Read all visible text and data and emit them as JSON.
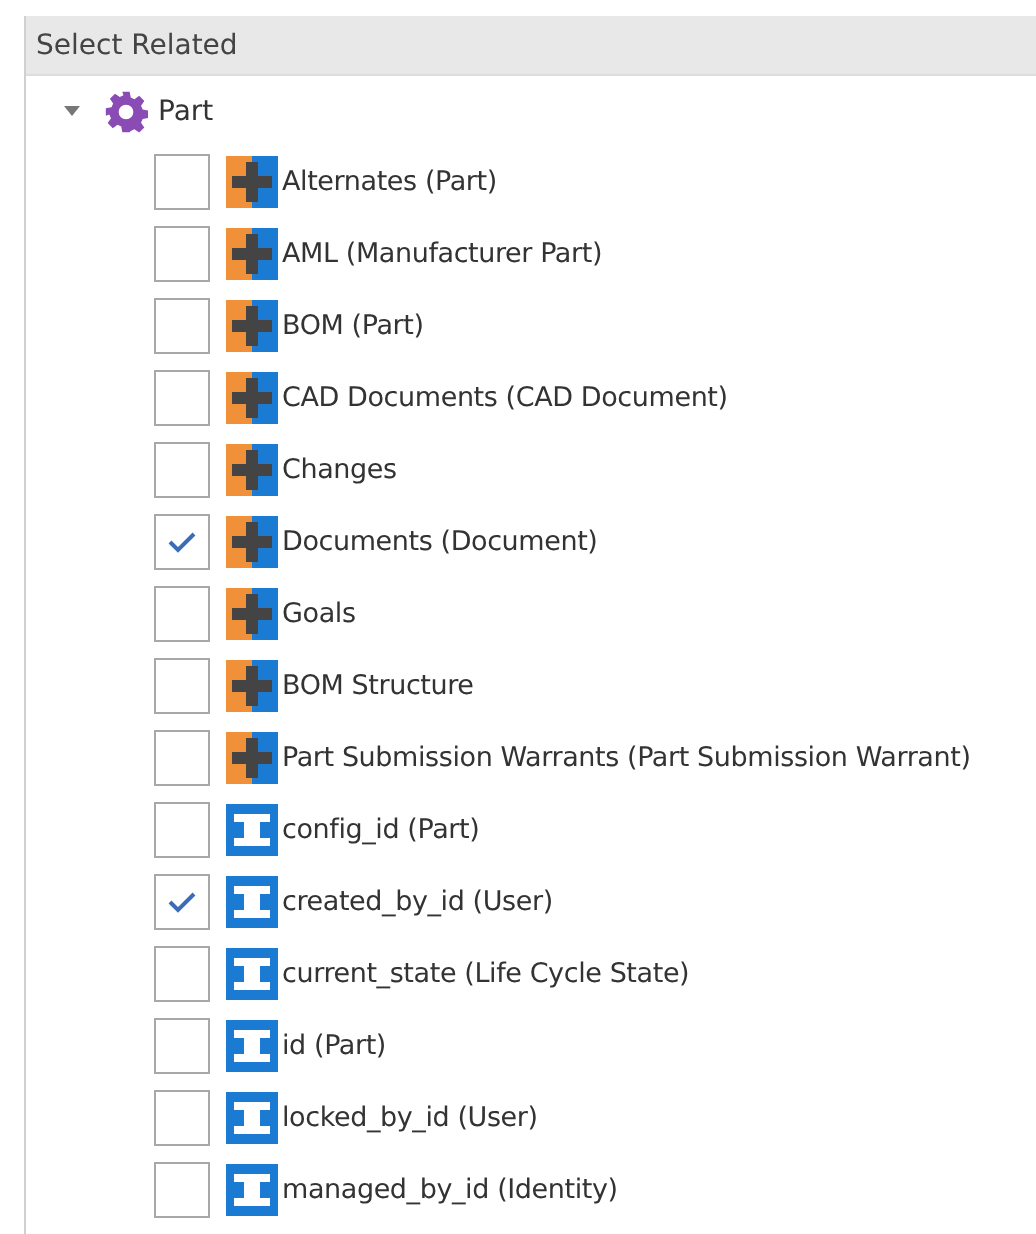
{
  "panel": {
    "title": "Select Related"
  },
  "tree": {
    "label": "Part",
    "expanded": true,
    "children": [
      {
        "label": "Alternates (Part)",
        "kind": "relationship",
        "checked": false
      },
      {
        "label": "AML (Manufacturer Part)",
        "kind": "relationship",
        "checked": false
      },
      {
        "label": "BOM (Part)",
        "kind": "relationship",
        "checked": false
      },
      {
        "label": "CAD Documents (CAD Document)",
        "kind": "relationship",
        "checked": false
      },
      {
        "label": "Changes",
        "kind": "relationship",
        "checked": false
      },
      {
        "label": "Documents (Document)",
        "kind": "relationship",
        "checked": true
      },
      {
        "label": "Goals",
        "kind": "relationship",
        "checked": false
      },
      {
        "label": "BOM Structure",
        "kind": "relationship",
        "checked": false
      },
      {
        "label": "Part Submission Warrants (Part Submission Warrant)",
        "kind": "relationship",
        "checked": false
      },
      {
        "label": "config_id (Part)",
        "kind": "property",
        "checked": false
      },
      {
        "label": "created_by_id (User)",
        "kind": "property",
        "checked": true
      },
      {
        "label": "current_state (Life Cycle State)",
        "kind": "property",
        "checked": false
      },
      {
        "label": "id (Part)",
        "kind": "property",
        "checked": false
      },
      {
        "label": "locked_by_id (User)",
        "kind": "property",
        "checked": false
      },
      {
        "label": "managed_by_id (Identity)",
        "kind": "property",
        "checked": false
      }
    ]
  }
}
